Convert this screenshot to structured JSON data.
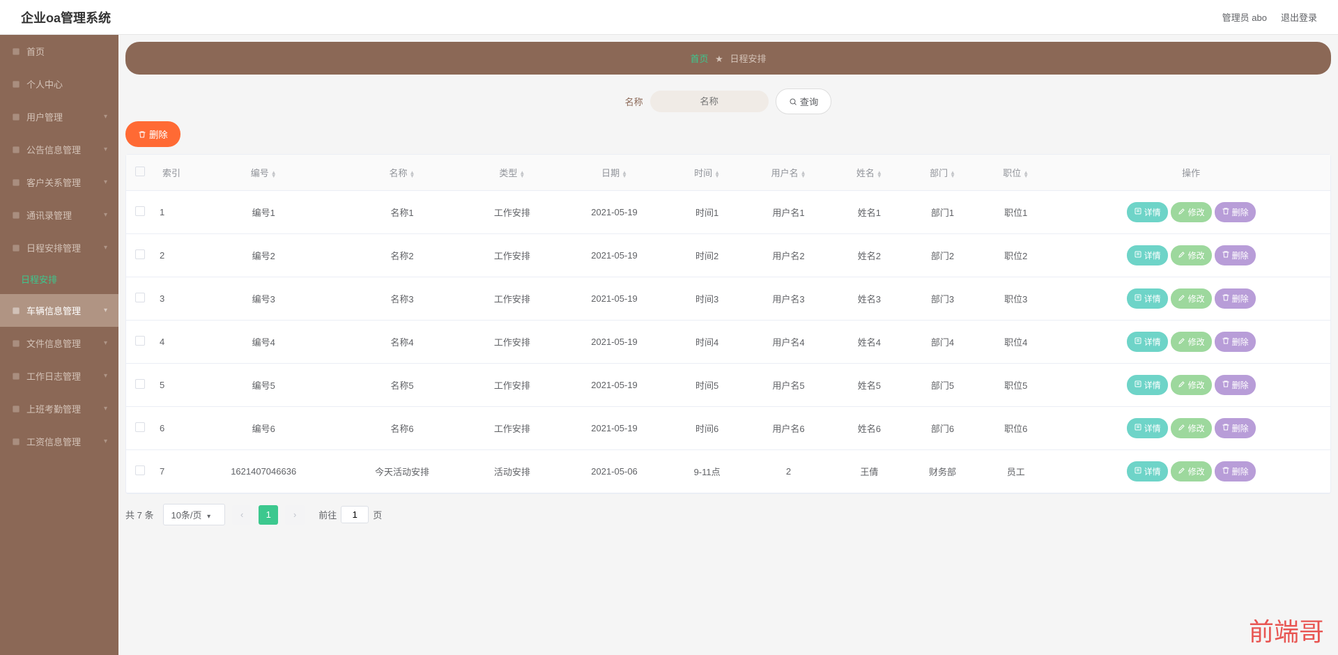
{
  "header": {
    "title": "企业oa管理系统",
    "admin": "管理员 abo",
    "logout": "退出登录"
  },
  "sidebar": {
    "items": [
      {
        "label": "首页",
        "icon": "home"
      },
      {
        "label": "个人中心",
        "icon": "user"
      },
      {
        "label": "用户管理",
        "icon": "users",
        "expandable": true
      },
      {
        "label": "公告信息管理",
        "icon": "doc",
        "expandable": true
      },
      {
        "label": "客户关系管理",
        "icon": "grid",
        "expandable": true
      },
      {
        "label": "通讯录管理",
        "icon": "book",
        "expandable": true
      },
      {
        "label": "日程安排管理",
        "icon": "calendar",
        "expandable": true,
        "expanded": true
      },
      {
        "label": "车辆信息管理",
        "icon": "car",
        "expandable": true,
        "hovered": true
      },
      {
        "label": "文件信息管理",
        "icon": "folder",
        "expandable": true
      },
      {
        "label": "工作日志管理",
        "icon": "note",
        "expandable": true
      },
      {
        "label": "上班考勤管理",
        "icon": "clock",
        "expandable": true
      },
      {
        "label": "工资信息管理",
        "icon": "money",
        "expandable": true
      }
    ],
    "subitem": "日程安排"
  },
  "breadcrumb": {
    "home": "首页",
    "current": "日程安排"
  },
  "search": {
    "label": "名称",
    "placeholder": "名称",
    "button": "查询"
  },
  "actions": {
    "delete": "删除"
  },
  "table": {
    "headers": [
      "索引",
      "编号",
      "名称",
      "类型",
      "日期",
      "时间",
      "用户名",
      "姓名",
      "部门",
      "职位",
      "操作"
    ],
    "rows": [
      {
        "idx": "1",
        "code": "编号1",
        "name": "名称1",
        "type": "工作安排",
        "date": "2021-05-19",
        "time": "时间1",
        "user": "用户名1",
        "realname": "姓名1",
        "dept": "部门1",
        "job": "职位1"
      },
      {
        "idx": "2",
        "code": "编号2",
        "name": "名称2",
        "type": "工作安排",
        "date": "2021-05-19",
        "time": "时间2",
        "user": "用户名2",
        "realname": "姓名2",
        "dept": "部门2",
        "job": "职位2"
      },
      {
        "idx": "3",
        "code": "编号3",
        "name": "名称3",
        "type": "工作安排",
        "date": "2021-05-19",
        "time": "时间3",
        "user": "用户名3",
        "realname": "姓名3",
        "dept": "部门3",
        "job": "职位3"
      },
      {
        "idx": "4",
        "code": "编号4",
        "name": "名称4",
        "type": "工作安排",
        "date": "2021-05-19",
        "time": "时间4",
        "user": "用户名4",
        "realname": "姓名4",
        "dept": "部门4",
        "job": "职位4"
      },
      {
        "idx": "5",
        "code": "编号5",
        "name": "名称5",
        "type": "工作安排",
        "date": "2021-05-19",
        "time": "时间5",
        "user": "用户名5",
        "realname": "姓名5",
        "dept": "部门5",
        "job": "职位5"
      },
      {
        "idx": "6",
        "code": "编号6",
        "name": "名称6",
        "type": "工作安排",
        "date": "2021-05-19",
        "time": "时间6",
        "user": "用户名6",
        "realname": "姓名6",
        "dept": "部门6",
        "job": "职位6"
      },
      {
        "idx": "7",
        "code": "1621407046636",
        "name": "今天活动安排",
        "type": "活动安排",
        "date": "2021-05-06",
        "time": "9-11点",
        "user": "2",
        "realname": "王倩",
        "dept": "财务部",
        "job": "员工"
      }
    ],
    "buttons": {
      "detail": "详情",
      "edit": "修改",
      "delete": "删除"
    }
  },
  "pagination": {
    "total": "共 7 条",
    "pageSize": "10条/页",
    "current": "1",
    "jumpLabel": "前往",
    "jumpValue": "1",
    "pageSuffix": "页"
  },
  "watermark": "前端哥"
}
